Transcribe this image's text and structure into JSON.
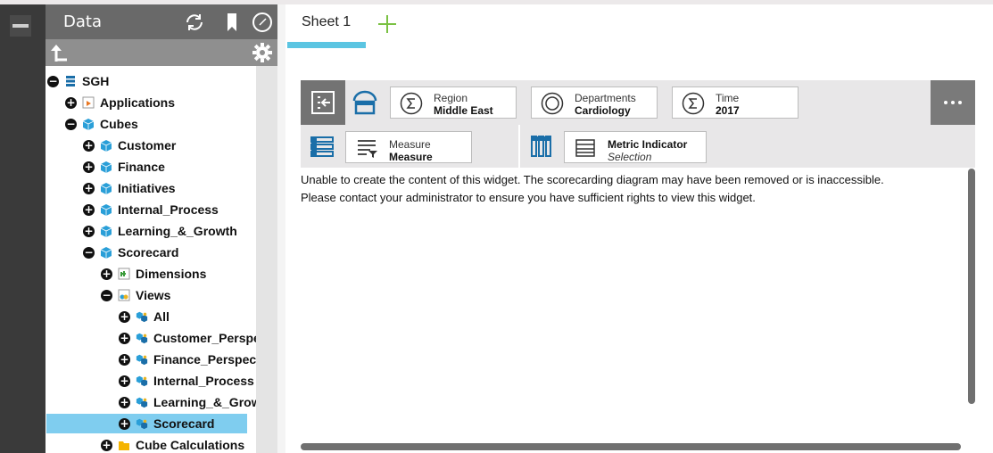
{
  "panel": {
    "title": "Data",
    "header_icons": [
      "refresh-icon",
      "bookmark-icon",
      "clock-icon"
    ],
    "tool_icons": [
      "up-level-icon",
      "gear-icon"
    ]
  },
  "tree": [
    {
      "label": "SGH",
      "toggle": "−",
      "icon": "database-icon",
      "depth": 0
    },
    {
      "label": "Applications",
      "toggle": "+",
      "icon": "application-icon",
      "depth": 1
    },
    {
      "label": "Cubes",
      "toggle": "−",
      "icon": "cube-icon",
      "depth": 1
    },
    {
      "label": "Customer",
      "toggle": "+",
      "icon": "cube-icon",
      "depth": 2
    },
    {
      "label": "Finance",
      "toggle": "+",
      "icon": "cube-icon",
      "depth": 2
    },
    {
      "label": "Initiatives",
      "toggle": "+",
      "icon": "cube-icon",
      "depth": 2
    },
    {
      "label": "Internal_Process",
      "toggle": "+",
      "icon": "cube-icon",
      "depth": 2
    },
    {
      "label": "Learning_&_Growth",
      "toggle": "+",
      "icon": "cube-icon",
      "depth": 2
    },
    {
      "label": "Scorecard",
      "toggle": "−",
      "icon": "cube-icon",
      "depth": 2
    },
    {
      "label": "Dimensions",
      "toggle": "+",
      "icon": "dimensions-icon",
      "depth": 3
    },
    {
      "label": "Views",
      "toggle": "−",
      "icon": "views-icon",
      "depth": 3
    },
    {
      "label": "All",
      "toggle": "+",
      "icon": "view-icon",
      "depth": 4
    },
    {
      "label": "Customer_Perspective",
      "toggle": "+",
      "icon": "view-icon",
      "depth": 4
    },
    {
      "label": "Finance_Perspective",
      "toggle": "+",
      "icon": "view-icon",
      "depth": 4
    },
    {
      "label": "Internal_Process",
      "toggle": "+",
      "icon": "view-icon",
      "depth": 4
    },
    {
      "label": "Learning_&_Growth",
      "toggle": "+",
      "icon": "view-icon",
      "depth": 4
    },
    {
      "label": "Scorecard",
      "toggle": "+",
      "icon": "view-icon",
      "depth": 4,
      "selected": true
    },
    {
      "label": "Cube Calculations",
      "toggle": "+",
      "icon": "folder-icon",
      "depth": 3
    }
  ],
  "tabs": {
    "sheet1": "Sheet 1",
    "add_icon": "plus-icon"
  },
  "widget": {
    "titles": {
      "region": {
        "label": "Region",
        "value": "Middle East",
        "icon": "sigma-icon"
      },
      "departments": {
        "label": "Departments",
        "value": "Cardiology",
        "icon": "circle-icon"
      },
      "time": {
        "label": "Time",
        "value": "2017",
        "icon": "sigma-icon"
      }
    },
    "rows": {
      "label": "Measure",
      "value": "Measure",
      "icon": "rows-icon"
    },
    "columns": {
      "label": "Metric Indicator",
      "value": "Selection",
      "icon": "columns-icon"
    },
    "message_line1": "Unable to create the content of this widget. The scorecarding diagram may have been removed or is inaccessible.",
    "message_line2": "Please contact your administrator to ensure you have sufficient rights to view this widget."
  },
  "colors": {
    "accent": "#5bc5e2",
    "selection": "#7fcdef",
    "add": "#7ac143"
  }
}
